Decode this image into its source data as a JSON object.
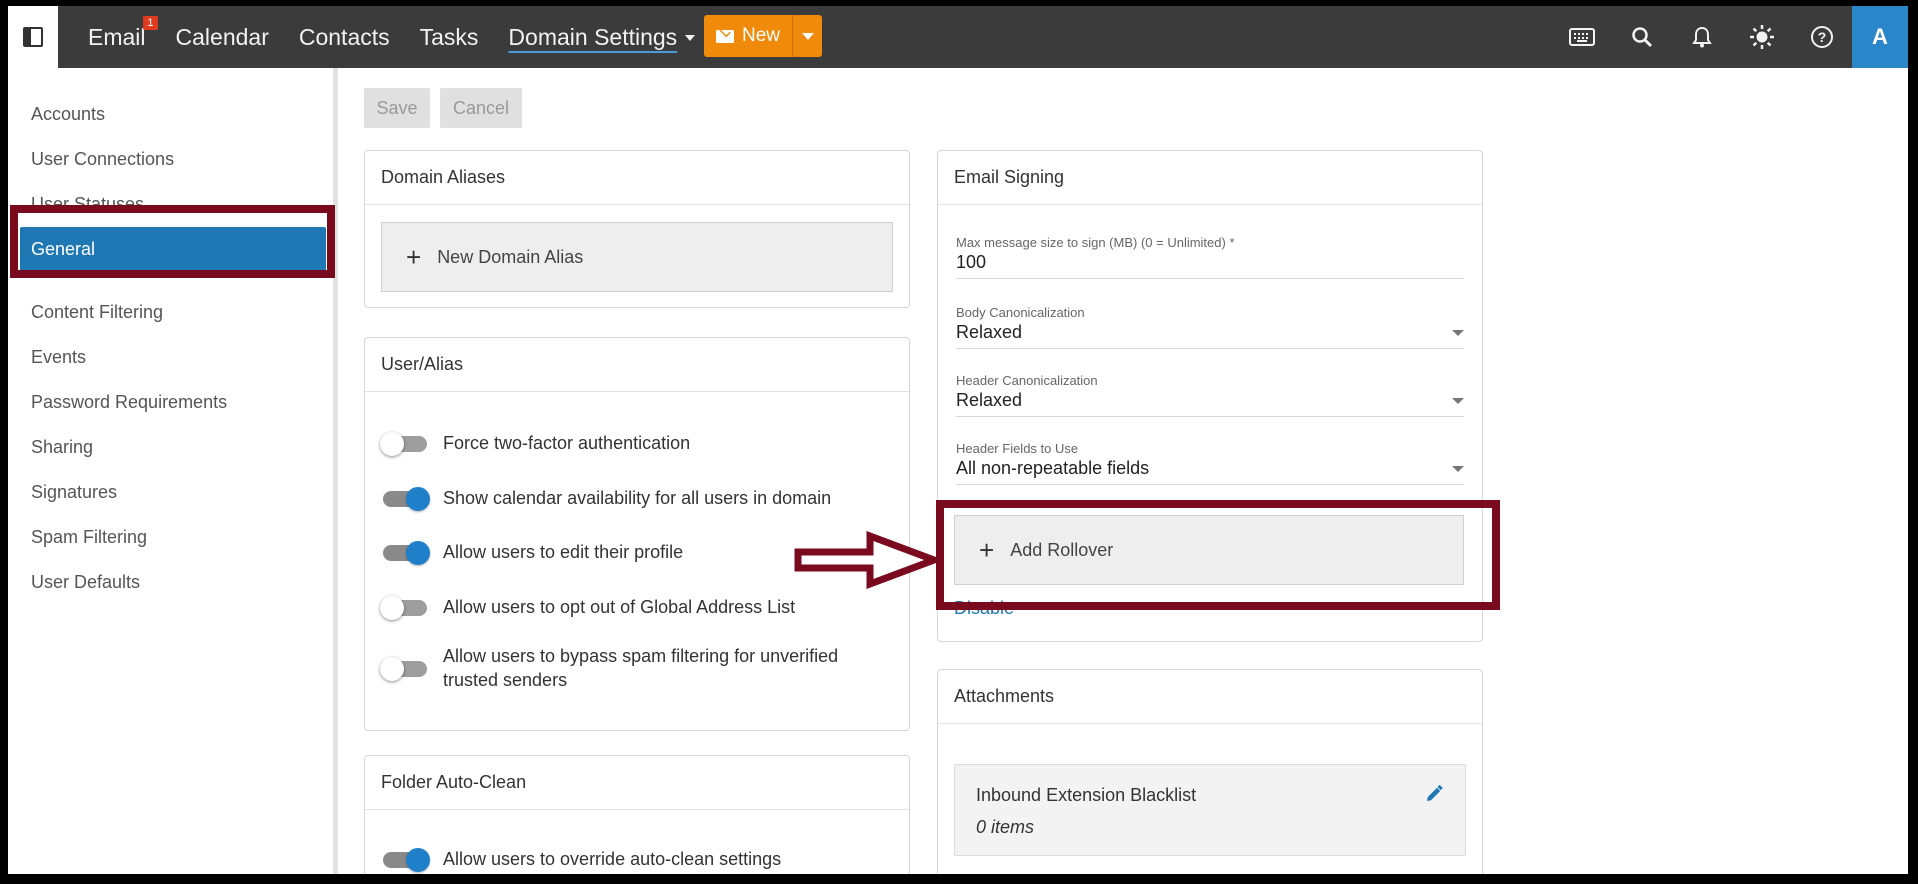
{
  "topbar": {
    "nav": [
      {
        "label": "Email",
        "badge": "1"
      },
      {
        "label": "Calendar"
      },
      {
        "label": "Contacts"
      },
      {
        "label": "Tasks"
      },
      {
        "label": "Domain Settings"
      }
    ],
    "new_label": "New",
    "avatar_letter": "A",
    "icons": [
      "keyboard-icon",
      "search-icon",
      "bell-icon",
      "brightness-icon",
      "help-icon"
    ]
  },
  "sidebar": {
    "items": [
      "Accounts",
      "User Connections",
      "User Statuses",
      "General",
      "Content Filtering",
      "Events",
      "Password Requirements",
      "Sharing",
      "Signatures",
      "Spam Filtering",
      "User Defaults"
    ],
    "selected": "General"
  },
  "toolbar": {
    "save_label": "Save",
    "cancel_label": "Cancel"
  },
  "domain_aliases": {
    "title": "Domain Aliases",
    "add_label": "New Domain Alias"
  },
  "user_alias": {
    "title": "User/Alias",
    "toggles": [
      {
        "label": "Force two-factor authentication",
        "on": false
      },
      {
        "label": "Show calendar availability for all users in domain",
        "on": true
      },
      {
        "label": "Allow users to edit their profile",
        "on": true
      },
      {
        "label": "Allow users to opt out of Global Address List",
        "on": false
      },
      {
        "label_line1": "Allow users to bypass spam filtering for unverified",
        "label_line2": "trusted senders",
        "on": false
      }
    ]
  },
  "folder_auto_clean": {
    "title": "Folder Auto-Clean",
    "toggles": [
      {
        "label": "Allow users to override auto-clean settings",
        "on": true
      }
    ]
  },
  "email_signing": {
    "title": "Email Signing",
    "max_size_label": "Max message size to sign (MB) (0 = Unlimited) *",
    "max_size_value": "100",
    "body_canon_label": "Body Canonicalization",
    "body_canon_value": "Relaxed",
    "header_canon_label": "Header Canonicalization",
    "header_canon_value": "Relaxed",
    "header_fields_label": "Header Fields to Use",
    "header_fields_value": "All non-repeatable fields",
    "add_rollover_label": "Add Rollover",
    "disable_label": "Disable"
  },
  "attachments": {
    "title": "Attachments",
    "blacklist_title": "Inbound Extension Blacklist",
    "blacklist_count": "0 items"
  },
  "colors": {
    "accent": "#1f78b4",
    "new_button": "#ef8a0a",
    "highlight": "#7a0a1e",
    "topbar": "#3b3b3b"
  }
}
